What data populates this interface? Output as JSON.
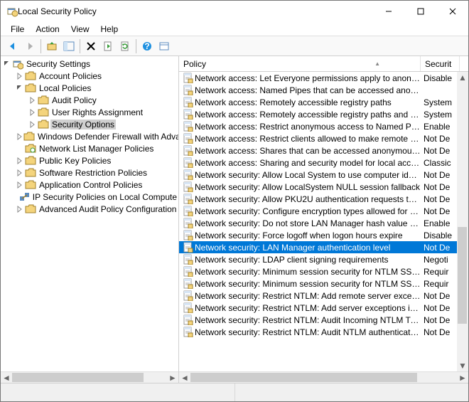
{
  "title": "Local Security Policy",
  "menu": {
    "file": "File",
    "action": "Action",
    "view": "View",
    "help": "Help"
  },
  "tree": {
    "root": "Security Settings",
    "items": [
      {
        "label": "Account Policies",
        "icon": "folder",
        "twisty": "closed",
        "depth": 1,
        "selected": false
      },
      {
        "label": "Local Policies",
        "icon": "folder",
        "twisty": "open",
        "depth": 1,
        "selected": false
      },
      {
        "label": "Audit Policy",
        "icon": "folder",
        "twisty": "closed",
        "depth": 2,
        "selected": false
      },
      {
        "label": "User Rights Assignment",
        "icon": "folder",
        "twisty": "closed",
        "depth": 2,
        "selected": false
      },
      {
        "label": "Security Options",
        "icon": "folder",
        "twisty": "closed",
        "depth": 2,
        "selected": true
      },
      {
        "label": "Windows Defender Firewall with Adva",
        "icon": "folder",
        "twisty": "closed",
        "depth": 1,
        "selected": false
      },
      {
        "label": "Network List Manager Policies",
        "icon": "folder-net",
        "twisty": "none",
        "depth": 1,
        "selected": false
      },
      {
        "label": "Public Key Policies",
        "icon": "folder",
        "twisty": "closed",
        "depth": 1,
        "selected": false
      },
      {
        "label": "Software Restriction Policies",
        "icon": "folder",
        "twisty": "closed",
        "depth": 1,
        "selected": false
      },
      {
        "label": "Application Control Policies",
        "icon": "folder",
        "twisty": "closed",
        "depth": 1,
        "selected": false
      },
      {
        "label": "IP Security Policies on Local Compute",
        "icon": "ipsec",
        "twisty": "none",
        "depth": 1,
        "selected": false
      },
      {
        "label": "Advanced Audit Policy Configuration",
        "icon": "folder",
        "twisty": "closed",
        "depth": 1,
        "selected": false
      }
    ]
  },
  "list": {
    "columns": {
      "policy": "Policy",
      "setting": "Securit"
    },
    "sort_indicator": "▲",
    "rows": [
      {
        "policy": "Network access: Let Everyone permissions apply to anony...",
        "setting": "Disable",
        "selected": false
      },
      {
        "policy": "Network access: Named Pipes that can be accessed anonym...",
        "setting": "",
        "selected": false
      },
      {
        "policy": "Network access: Remotely accessible registry paths",
        "setting": "System",
        "selected": false
      },
      {
        "policy": "Network access: Remotely accessible registry paths and sub...",
        "setting": "System",
        "selected": false
      },
      {
        "policy": "Network access: Restrict anonymous access to Named Pipes...",
        "setting": "Enable",
        "selected": false
      },
      {
        "policy": "Network access: Restrict clients allowed to make remote call...",
        "setting": "Not De",
        "selected": false
      },
      {
        "policy": "Network access: Shares that can be accessed anonymously",
        "setting": "Not De",
        "selected": false
      },
      {
        "policy": "Network access: Sharing and security model for local accou...",
        "setting": "Classic",
        "selected": false
      },
      {
        "policy": "Network security: Allow Local System to use computer ident...",
        "setting": "Not De",
        "selected": false
      },
      {
        "policy": "Network security: Allow LocalSystem NULL session fallback",
        "setting": "Not De",
        "selected": false
      },
      {
        "policy": "Network security: Allow PKU2U authentication requests to t...",
        "setting": "Not De",
        "selected": false
      },
      {
        "policy": "Network security: Configure encryption types allowed for Ke...",
        "setting": "Not De",
        "selected": false
      },
      {
        "policy": "Network security: Do not store LAN Manager hash value on ...",
        "setting": "Enable",
        "selected": false
      },
      {
        "policy": "Network security: Force logoff when logon hours expire",
        "setting": "Disable",
        "selected": false
      },
      {
        "policy": "Network security: LAN Manager authentication level",
        "setting": "Not De",
        "selected": true
      },
      {
        "policy": "Network security: LDAP client signing requirements",
        "setting": "Negoti",
        "selected": false
      },
      {
        "policy": "Network security: Minimum session security for NTLM SSP ...",
        "setting": "Requir",
        "selected": false
      },
      {
        "policy": "Network security: Minimum session security for NTLM SSP ...",
        "setting": "Requir",
        "selected": false
      },
      {
        "policy": "Network security: Restrict NTLM: Add remote server excepti...",
        "setting": "Not De",
        "selected": false
      },
      {
        "policy": "Network security: Restrict NTLM: Add server exceptions in t...",
        "setting": "Not De",
        "selected": false
      },
      {
        "policy": "Network security: Restrict NTLM: Audit Incoming NTLM Traf...",
        "setting": "Not De",
        "selected": false
      },
      {
        "policy": "Network security: Restrict NTLM: Audit NTLM authentication...",
        "setting": "Not De",
        "selected": false
      }
    ]
  }
}
